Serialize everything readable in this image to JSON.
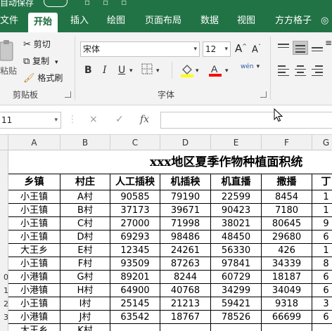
{
  "window": {
    "autosave_label": "自动保存",
    "accent": "#217346"
  },
  "tabs": [
    {
      "label": "文件"
    },
    {
      "label": "开始",
      "active": true
    },
    {
      "label": "插入"
    },
    {
      "label": "绘图"
    },
    {
      "label": "页面布局"
    },
    {
      "label": "数据"
    },
    {
      "label": "视图"
    },
    {
      "label": "方方格子"
    },
    {
      "label": "◎"
    }
  ],
  "ribbon": {
    "clipboard": {
      "paste": "粘贴",
      "cut": "剪切",
      "copy": "复制",
      "format_painter": "格式刷",
      "group_label": "剪贴板"
    },
    "font": {
      "font_name": "宋体",
      "font_size": "12",
      "grow": "A",
      "shrink": "A",
      "bold": "B",
      "italic": "I",
      "underline": "U",
      "fill_color": "#ffff00",
      "font_color": "#ff0000",
      "phonetic": "wén",
      "group_label": "字体"
    }
  },
  "formula_bar": {
    "name_box": "11",
    "cancel_icon": "×",
    "enter_icon": "✓",
    "fx": "fx",
    "formula": ""
  },
  "columns": [
    "A",
    "B",
    "C",
    "D",
    "E",
    "F",
    "G"
  ],
  "rows": [
    "",
    "",
    "",
    "",
    "",
    "",
    "",
    "0",
    "1",
    "2",
    "3"
  ],
  "sheet": {
    "title": "xxx地区夏季作物种植面积统",
    "headers": [
      "乡镇",
      "村庄",
      "人工插秧",
      "机插秧",
      "机直播",
      "撒播",
      "丁"
    ],
    "data": [
      [
        "小王镇",
        "A村",
        "90585",
        "79190",
        "22599",
        "8454",
        "1"
      ],
      [
        "小王镇",
        "B村",
        "37173",
        "39671",
        "90423",
        "7180",
        "1"
      ],
      [
        "小王镇",
        "C村",
        "27000",
        "71998",
        "38021",
        "80645",
        "9"
      ],
      [
        "小王镇",
        "D村",
        "69293",
        "98486",
        "48450",
        "29680",
        "6"
      ],
      [
        "大王乡",
        "E村",
        "12345",
        "24261",
        "56330",
        "426",
        "1"
      ],
      [
        "小王镇",
        "F村",
        "93509",
        "87263",
        "97841",
        "34339",
        "8"
      ],
      [
        "小港镇",
        "G村",
        "89201",
        "8244",
        "60729",
        "18187",
        "6"
      ],
      [
        "小港镇",
        "H村",
        "64900",
        "40768",
        "34299",
        "34049",
        "6"
      ],
      [
        "小王镇",
        "I村",
        "25145",
        "21213",
        "59421",
        "9318",
        "3"
      ],
      [
        "小港镇",
        "J村",
        "63542",
        "18767",
        "78526",
        "66699",
        "6"
      ],
      [
        "大王乡",
        "K村",
        "",
        "",
        "",
        "",
        ""
      ]
    ]
  }
}
